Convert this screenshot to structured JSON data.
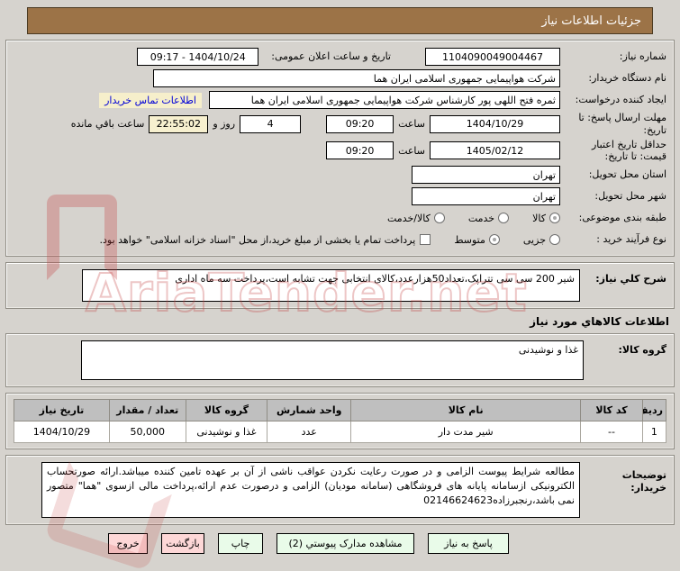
{
  "title": "جزئیات اطلاعات نیاز",
  "form": {
    "need_number": {
      "label": "شماره نیاز:",
      "value": "1104090049004467"
    },
    "announce_datetime": {
      "label": "تاریخ و ساعت اعلان عمومی:",
      "value": "1404/10/24 - 09:17"
    },
    "buyer_org": {
      "label": "نام دستگاه خریدار:",
      "value": "شرکت هواپیمایی جمهوری اسلامی ایران هما"
    },
    "request_creator": {
      "label": "ایجاد کننده درخواست:",
      "value": "ثمره فتح اللهی پور کارشناس شرکت هواپیمایی جمهوری اسلامی ایران هما",
      "contact_link": "اطلاعات تماس خریدار"
    },
    "response_deadline": {
      "label": "مهلت ارسال پاسخ: تا تاریخ:",
      "date": "1404/10/29",
      "hour_label": "ساعت",
      "time": "09:20",
      "days_value": "4",
      "days_label": "روز و",
      "countdown": "22:55:02",
      "countdown_label": "ساعت باقي مانده"
    },
    "price_validity": {
      "label": "حداقل تاریخ اعتبار قیمت: تا تاریخ:",
      "date": "1405/02/12",
      "hour_label": "ساعت",
      "time": "09:20"
    },
    "province": {
      "label": "استان محل تحویل:",
      "value": "تهران"
    },
    "city": {
      "label": "شهر محل تحویل:",
      "value": "تهران"
    },
    "subject_class": {
      "label": "طبقه بندی موضوعی:",
      "options": [
        {
          "label": "کالا",
          "selected": true
        },
        {
          "label": "خدمت",
          "selected": false
        },
        {
          "label": "کالا/خدمت",
          "selected": false
        }
      ]
    },
    "purchase_process": {
      "label": "نوع فرآیند خرید :",
      "options": [
        {
          "label": "جزیی",
          "selected": false
        },
        {
          "label": "متوسط",
          "selected": true
        }
      ],
      "treasury_checkbox": {
        "label": "پرداخت تمام یا بخشی از مبلغ خرید،از محل \"اسناد خزانه اسلامی\" خواهد بود.",
        "checked": false
      }
    }
  },
  "need_description": {
    "label": "شرح کلي نیاز:",
    "value": "شیر 200 سی سی تتراپک،تعداد50هزارعدد،کالای انتخابی جهت تشابه است،پرداخت سه ماه اداری"
  },
  "goods_section": {
    "heading": "اطلاعات کالاهاي مورد نیاز",
    "group_label": "گروه کالا:",
    "group_value": "غذا و نوشیدنی"
  },
  "goods_table": {
    "headers": [
      "ردیف",
      "کد کالا",
      "نام کالا",
      "واحد شمارش",
      "گروه کالا",
      "تعداد / مقدار",
      "تاریخ نیاز"
    ],
    "rows": [
      [
        "1",
        "--",
        "شیر مدت دار",
        "عدد",
        "غذا و نوشیدنی",
        "50,000",
        "1404/10/29"
      ]
    ]
  },
  "buyer_notes": {
    "label": "توضیحات خریدار:",
    "value": "مطالعه شرایط پیوست الزامی و در صورت رعایت نکردن عواقب ناشی از آن بر عهده تامین کننده میباشد.ارائه صورتحساب الکترونیکی ازسامانه پایانه های فروشگاهی (سامانه مودیان) الزامی و درصورت عدم ارائه،پرداخت مالی ازسوی \"هما\" متصور نمی باشد،رنجبرزاده02146624623"
  },
  "buttons": {
    "respond": "پاسخ به نیاز",
    "view_docs": "مشاهده مدارک پیوستي (2)",
    "print": "چاپ",
    "back": "بازگشت",
    "exit": "خروج"
  },
  "watermark": "AriaTender.net",
  "colors": {
    "header_brown": "#9c7347",
    "page_gray": "#d6d3ce",
    "link_blue": "#0000d8",
    "countdown_yellow": "#f7f0cf",
    "button_green": "#e9fbe9",
    "button_pink": "#fdd7d7",
    "watermark_red": "#c34141"
  }
}
